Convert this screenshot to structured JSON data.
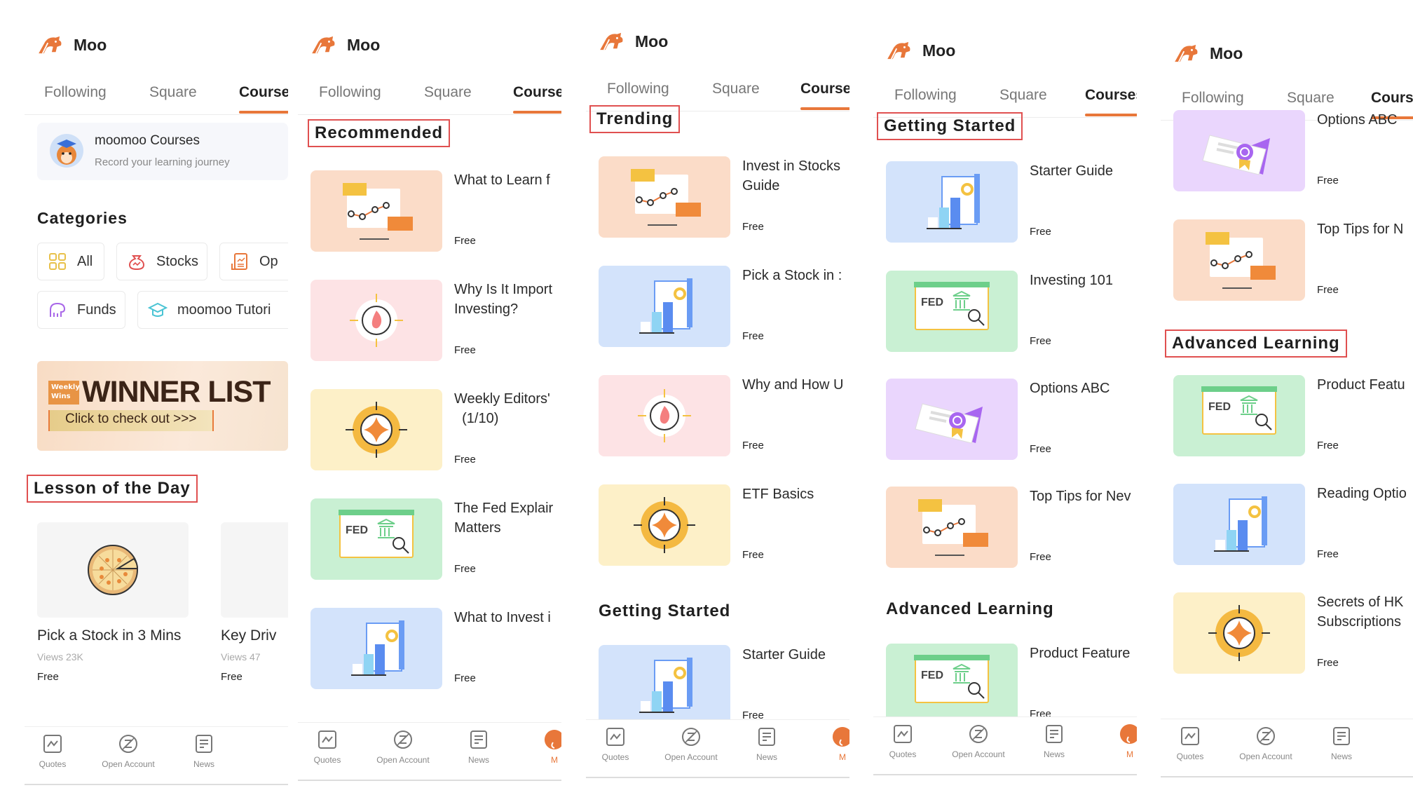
{
  "app": {
    "title": "Moo",
    "accent": "#e8773a"
  },
  "tabs": [
    "Following",
    "Square",
    "Courses"
  ],
  "active_tab": "Courses",
  "bottom_nav": [
    {
      "label": "Quotes",
      "icon": "chart-icon"
    },
    {
      "label": "Open Account",
      "icon": "open-account-icon"
    },
    {
      "label": "News",
      "icon": "news-icon"
    },
    {
      "label": "M",
      "icon": "me-icon"
    }
  ],
  "panel1": {
    "card": {
      "name": "moomoo Courses",
      "subtitle": "Record your learning journey"
    },
    "categories_title": "Categories",
    "categories": [
      {
        "label": "All",
        "icon": "grid-icon"
      },
      {
        "label": "Stocks",
        "icon": "money-bag-icon"
      },
      {
        "label": "Op",
        "icon": "options-document-icon"
      },
      {
        "label": "Funds",
        "icon": "funds-icon"
      },
      {
        "label": "moomoo Tutori",
        "icon": "graduation-cap-icon"
      }
    ],
    "banner": {
      "badge": "Weekly Wins",
      "title": "WINNER LIST",
      "cta": "Click to check out  >>>"
    },
    "lesson_title": "Lesson of the Day",
    "lessons": [
      {
        "title": "Pick a Stock in 3 Mins",
        "views": "Views 23K",
        "price": "Free"
      },
      {
        "title": "Key Driv",
        "views": "Views 47",
        "price": "Free"
      }
    ]
  },
  "panel2": {
    "section": "Recommended",
    "courses": [
      {
        "title": "What to Learn f",
        "price": "Free",
        "theme": "orange"
      },
      {
        "title": "Why Is It Import\nInvesting?",
        "price": "Free",
        "theme": "pink"
      },
      {
        "title": "Weekly Editors'\n  (1/10)",
        "price": "Free",
        "theme": "yellow"
      },
      {
        "title": "The Fed Explair\nMatters",
        "price": "Free",
        "theme": "green"
      },
      {
        "title": "What to Invest i",
        "price": "Free",
        "theme": "blue"
      }
    ]
  },
  "panel3": {
    "section": "Trending",
    "courses": [
      {
        "title": "Invest in Stocks\nGuide",
        "price": "Free",
        "theme": "orange"
      },
      {
        "title": "Pick a Stock in :",
        "price": "Free",
        "theme": "blue"
      },
      {
        "title": "Why and How U",
        "price": "Free",
        "theme": "pink"
      },
      {
        "title": "ETF Basics",
        "price": "Free",
        "theme": "yellow"
      }
    ],
    "section2": "Getting Started",
    "courses2": [
      {
        "title": "Starter Guide",
        "price": "Free",
        "theme": "blue"
      }
    ]
  },
  "panel4": {
    "section": "Getting Started",
    "courses": [
      {
        "title": "Starter Guide",
        "price": "Free",
        "theme": "blue"
      },
      {
        "title": "Investing 101",
        "price": "Free",
        "theme": "green"
      },
      {
        "title": "Options ABC",
        "price": "Free",
        "theme": "purple"
      },
      {
        "title": "Top Tips for Nev",
        "price": "Free",
        "theme": "orange"
      }
    ],
    "section2": "Advanced Learning",
    "courses2": [
      {
        "title": "Product Feature",
        "price": "Free",
        "theme": "green"
      }
    ]
  },
  "panel5": {
    "courses": [
      {
        "title": "Options ABC",
        "price": "Free",
        "theme": "purple"
      },
      {
        "title": "Top Tips for N",
        "price": "Free",
        "theme": "orange"
      }
    ],
    "section": "Advanced Learning",
    "courses2": [
      {
        "title": "Product Featu",
        "price": "Free",
        "theme": "green"
      },
      {
        "title": "Reading Optio",
        "price": "Free",
        "theme": "blue"
      },
      {
        "title": "Secrets of HK\nSubscriptions",
        "price": "Free",
        "theme": "yellow"
      }
    ]
  },
  "theme_colors": {
    "orange": "#fbdcc8",
    "pink": "#fde3e5",
    "yellow": "#fdf0c8",
    "green": "#c9f0d3",
    "blue": "#d3e3fb",
    "purple": "#ead6fd"
  }
}
